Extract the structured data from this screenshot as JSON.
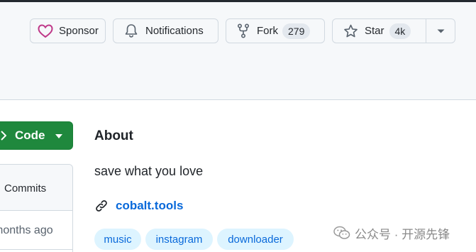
{
  "header": {
    "sponsor_label": "Sponsor",
    "notifications_label": "Notifications",
    "fork_label": "Fork",
    "fork_count": "279",
    "star_label": "Star",
    "star_count": "4k"
  },
  "code": {
    "label": "Code"
  },
  "files": {
    "commits_label": "Commits",
    "updated_text": "months ago"
  },
  "about": {
    "title": "About",
    "description": "save what you love",
    "website": "cobalt.tools",
    "topics": [
      "music",
      "instagram",
      "downloader"
    ]
  },
  "watermark": {
    "text": "公众号 · 开源先锋"
  },
  "colors": {
    "accent_green": "#1f883d",
    "link_blue": "#0969da",
    "topic_bg": "#ddf4ff",
    "sponsor_pink": "#bf3989"
  }
}
